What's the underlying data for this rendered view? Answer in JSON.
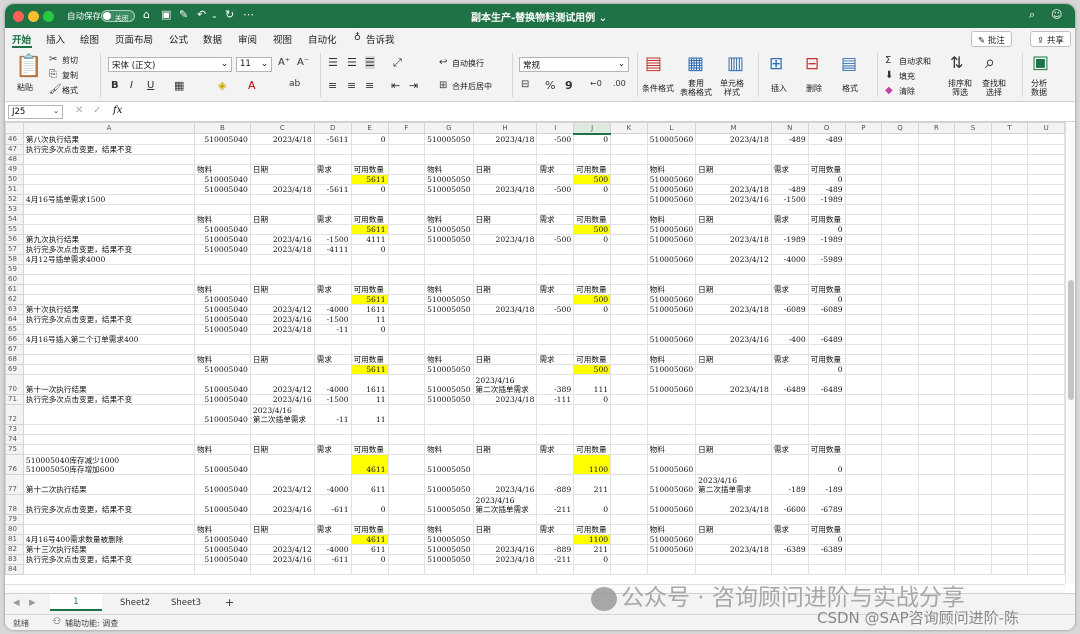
{
  "titlebar": {
    "autosave_label": "自动保存",
    "autosave_state": "关闭",
    "document_title": "副本生产-替换物料测试用例 ⌄"
  },
  "menu": {
    "tabs": [
      "开始",
      "插入",
      "绘图",
      "页面布局",
      "公式",
      "数据",
      "审阅",
      "视图",
      "自动化",
      "告诉我"
    ],
    "comments_label": "批注",
    "share_label": "共享"
  },
  "ribbon": {
    "paste": "粘贴",
    "cut": "剪切",
    "copy": "复制",
    "format_painter": "格式",
    "font_name": "宋体 (正文)",
    "font_size": "11",
    "wrap_text": "自动换行",
    "merge_center": "合并后居中",
    "number_format": "常规",
    "conditional_format": "条件格式",
    "table_format": "套用\n表格格式",
    "cell_styles": "单元格\n样式",
    "insert": "插入",
    "delete": "删除",
    "format": "格式",
    "autosum": "自动求和",
    "fill": "填充",
    "clear": "清除",
    "sort_filter": "排序和\n筛选",
    "find_select": "查找和\n选择",
    "analyze": "分析\n数据"
  },
  "formula_bar": {
    "name_box": "J25",
    "fx": "fx",
    "formula": ""
  },
  "columns": [
    "",
    "A",
    "B",
    "C",
    "D",
    "E",
    "F",
    "G",
    "H",
    "I",
    "J",
    "K",
    "L",
    "M",
    "N",
    "O",
    "P",
    "Q",
    "R",
    "S",
    "T",
    "U"
  ],
  "selected_column": "J",
  "rows": [
    {
      "n": "46",
      "c": [
        "第八次执行结果",
        "510005040",
        "2023/4/18",
        "-5611",
        "0",
        "",
        "510005050",
        "2023/4/18",
        "-500",
        "0",
        "",
        "510005060",
        "2023/4/18",
        "-489",
        "-489"
      ]
    },
    {
      "n": "47",
      "c": [
        "执行完多次点击变更，结果不变",
        "",
        "",
        "",
        "",
        "",
        "",
        "",
        "",
        "",
        "",
        "",
        "",
        "",
        ""
      ]
    },
    {
      "n": "48",
      "c": [
        "",
        "",
        "",
        "",
        "",
        "",
        "",
        "",
        "",
        "",
        "",
        "",
        "",
        "",
        ""
      ]
    },
    {
      "n": "49",
      "c": [
        "",
        "物料",
        "日期",
        "需求",
        "可用数量",
        "",
        "物料",
        "日期",
        "需求",
        "可用数量",
        "",
        "物料",
        "日期",
        "需求",
        "可用数量"
      ]
    },
    {
      "n": "50",
      "c": [
        "",
        "510005040",
        "",
        "",
        "5611",
        "",
        "510005050",
        "",
        "",
        "500",
        "",
        "510005060",
        "",
        "",
        "0"
      ],
      "y": [
        4,
        9
      ]
    },
    {
      "n": "51",
      "c": [
        "",
        "510005040",
        "2023/4/18",
        "-5611",
        "0",
        "",
        "510005050",
        "2023/4/18",
        "-500",
        "0",
        "",
        "510005060",
        "2023/4/18",
        "-489",
        "-489"
      ]
    },
    {
      "n": "52",
      "c": [
        "4月16号插单需求1500",
        "",
        "",
        "",
        "",
        "",
        "",
        "",
        "",
        "",
        "",
        "510005060",
        "2023/4/16",
        "-1500",
        "-1989"
      ]
    },
    {
      "n": "53",
      "c": [
        "",
        "",
        "",
        "",
        "",
        "",
        "",
        "",
        "",
        "",
        "",
        "",
        "",
        "",
        ""
      ]
    },
    {
      "n": "54",
      "c": [
        "",
        "物料",
        "日期",
        "需求",
        "可用数量",
        "",
        "物料",
        "日期",
        "需求",
        "可用数量",
        "",
        "物料",
        "日期",
        "需求",
        "可用数量"
      ]
    },
    {
      "n": "55",
      "c": [
        "",
        "510005040",
        "",
        "",
        "5611",
        "",
        "510005050",
        "",
        "",
        "500",
        "",
        "510005060",
        "",
        "",
        "0"
      ],
      "y": [
        4,
        9
      ]
    },
    {
      "n": "56",
      "c": [
        "第九次执行结果",
        "510005040",
        "2023/4/16",
        "-1500",
        "4111",
        "",
        "510005050",
        "2023/4/18",
        "-500",
        "0",
        "",
        "510005060",
        "2023/4/18",
        "-1989",
        "-1989"
      ]
    },
    {
      "n": "57",
      "c": [
        "执行完多次点击变更，结果不变",
        "510005040",
        "2023/4/18",
        "-4111",
        "0",
        "",
        "",
        "",
        "",
        "",
        "",
        "",
        "",
        "",
        ""
      ]
    },
    {
      "n": "58",
      "c": [
        "4月12号插单需求4000",
        "",
        "",
        "",
        "",
        "",
        "",
        "",
        "",
        "",
        "",
        "510005060",
        "2023/4/12",
        "-4000",
        "-5989"
      ]
    },
    {
      "n": "59",
      "c": [
        "",
        "",
        "",
        "",
        "",
        "",
        "",
        "",
        "",
        "",
        "",
        "",
        "",
        "",
        ""
      ]
    },
    {
      "n": "60",
      "c": [
        "",
        "",
        "",
        "",
        "",
        "",
        "",
        "",
        "",
        "",
        "",
        "",
        "",
        "",
        ""
      ]
    },
    {
      "n": "61",
      "c": [
        "",
        "物料",
        "日期",
        "需求",
        "可用数量",
        "",
        "物料",
        "日期",
        "需求",
        "可用数量",
        "",
        "物料",
        "日期",
        "需求",
        "可用数量"
      ]
    },
    {
      "n": "62",
      "c": [
        "",
        "510005040",
        "",
        "",
        "5611",
        "",
        "510005050",
        "",
        "",
        "500",
        "",
        "510005060",
        "",
        "",
        "0"
      ],
      "y": [
        4,
        9
      ]
    },
    {
      "n": "63",
      "c": [
        "第十次执行结果",
        "510005040",
        "2023/4/12",
        "-4000",
        "1611",
        "",
        "510005050",
        "2023/4/18",
        "-500",
        "0",
        "",
        "510005060",
        "2023/4/18",
        "-6089",
        "-6089"
      ]
    },
    {
      "n": "64",
      "c": [
        "执行完多次点击变更，结果不变",
        "510005040",
        "2023/4/16",
        "-1500",
        "11",
        "",
        "",
        "",
        "",
        "",
        "",
        "",
        "",
        "",
        ""
      ]
    },
    {
      "n": "65",
      "c": [
        "",
        "510005040",
        "2023/4/18",
        "-11",
        "0",
        "",
        "",
        "",
        "",
        "",
        "",
        "",
        "",
        "",
        ""
      ]
    },
    {
      "n": "66",
      "c": [
        "4月16号插入第二个订单需求400",
        "",
        "",
        "",
        "",
        "",
        "",
        "",
        "",
        "",
        "",
        "510005060",
        "2023/4/16",
        "-400",
        "-6489"
      ]
    },
    {
      "n": "67",
      "c": [
        "",
        "",
        "",
        "",
        "",
        "",
        "",
        "",
        "",
        "",
        "",
        "",
        "",
        "",
        ""
      ]
    },
    {
      "n": "68",
      "c": [
        "",
        "物料",
        "日期",
        "需求",
        "可用数量",
        "",
        "物料",
        "日期",
        "需求",
        "可用数量",
        "",
        "物料",
        "日期",
        "需求",
        "可用数量"
      ]
    },
    {
      "n": "69",
      "c": [
        "",
        "510005040",
        "",
        "",
        "5611",
        "",
        "510005050",
        "",
        "",
        "500",
        "",
        "510005060",
        "",
        "",
        "0"
      ],
      "y": [
        4,
        9
      ]
    },
    {
      "n": "70",
      "c": [
        "第十一次执行结果",
        "510005040",
        "2023/4/12",
        "-4000",
        "1611",
        "",
        "510005050",
        "2023/4/16\n第二次插单需求",
        "-389",
        "111",
        "",
        "510005060",
        "2023/4/18",
        "-6489",
        "-6489"
      ],
      "tall": true
    },
    {
      "n": "71",
      "c": [
        "执行完多次点击变更，结果不变",
        "510005040",
        "2023/4/16",
        "-1500",
        "11",
        "",
        "510005050",
        "2023/4/18",
        "-111",
        "0",
        "",
        "",
        "",
        "",
        ""
      ]
    },
    {
      "n": "72",
      "c": [
        "",
        "510005040",
        "2023/4/16\n第二次插单需求",
        "-11",
        "11",
        "",
        "",
        "",
        "",
        "",
        "",
        "",
        "",
        "",
        ""
      ],
      "tall": true
    },
    {
      "n": "73",
      "c": [
        "",
        "",
        "",
        "",
        "",
        "",
        "",
        "",
        "",
        "",
        "",
        "",
        "",
        "",
        ""
      ]
    },
    {
      "n": "74",
      "c": [
        "",
        "",
        "",
        "",
        "",
        "",
        "",
        "",
        "",
        "",
        "",
        "",
        "",
        "",
        ""
      ]
    },
    {
      "n": "75",
      "c": [
        "",
        "物料",
        "日期",
        "需求",
        "可用数量",
        "",
        "物料",
        "日期",
        "需求",
        "可用数量",
        "",
        "物料",
        "日期",
        "需求",
        "可用数量"
      ]
    },
    {
      "n": "76",
      "c": [
        "510005040库存减少1000\n510005050库存增加600",
        "510005040",
        "",
        "",
        "4611",
        "",
        "510005050",
        "",
        "",
        "1100",
        "",
        "510005060",
        "",
        "",
        "0"
      ],
      "y": [
        4,
        9
      ],
      "tall": true
    },
    {
      "n": "77",
      "c": [
        "第十二次执行结果",
        "510005040",
        "2023/4/12",
        "-4000",
        "611",
        "",
        "510005050",
        "2023/4/16",
        "-889",
        "211",
        "",
        "510005060",
        "2023/4/16\n第二次插单需求",
        "-189",
        "-189"
      ],
      "tall": true
    },
    {
      "n": "78",
      "c": [
        "执行完多次点击变更，结果不变",
        "510005040",
        "2023/4/16",
        "-611",
        "0",
        "",
        "510005050",
        "2023/4/16\n第二次插单需求",
        "-211",
        "0",
        "",
        "510005060",
        "2023/4/18",
        "-6600",
        "-6789"
      ],
      "tall": true
    },
    {
      "n": "79",
      "c": [
        "",
        "",
        "",
        "",
        "",
        "",
        "",
        "",
        "",
        "",
        "",
        "",
        "",
        "",
        ""
      ]
    },
    {
      "n": "80",
      "c": [
        "",
        "物料",
        "日期",
        "需求",
        "可用数量",
        "",
        "物料",
        "日期",
        "需求",
        "可用数量",
        "",
        "物料",
        "日期",
        "需求",
        "可用数量"
      ]
    },
    {
      "n": "81",
      "c": [
        "4月16号400需求数量被删除",
        "510005040",
        "",
        "",
        "4611",
        "",
        "510005050",
        "",
        "",
        "1100",
        "",
        "510005060",
        "",
        "",
        "0"
      ],
      "y": [
        4,
        9
      ]
    },
    {
      "n": "82",
      "c": [
        "第十三次执行结果",
        "510005040",
        "2023/4/12",
        "-4000",
        "611",
        "",
        "510005050",
        "2023/4/16",
        "-889",
        "211",
        "",
        "510005060",
        "2023/4/18",
        "-6389",
        "-6389"
      ]
    },
    {
      "n": "83",
      "c": [
        "执行完多次点击变更，结果不变",
        "510005040",
        "2023/4/16",
        "-611",
        "0",
        "",
        "510005050",
        "2023/4/18",
        "-211",
        "0",
        "",
        "",
        "",
        "",
        ""
      ]
    },
    {
      "n": "84",
      "c": [
        "",
        "",
        "",
        "",
        "",
        "",
        "",
        "",
        "",
        "",
        "",
        "",
        "",
        "",
        ""
      ]
    }
  ],
  "sheets": {
    "active": "1",
    "others": [
      "Sheet2",
      "Sheet3"
    ],
    "add": "+"
  },
  "status": {
    "ready": "就绪",
    "accessibility": "辅助功能: 调查"
  },
  "watermark": {
    "line1": "公众号 · 咨询顾问进阶与实战分享",
    "line2": "CSDN @SAP咨询顾问进阶-陈"
  }
}
